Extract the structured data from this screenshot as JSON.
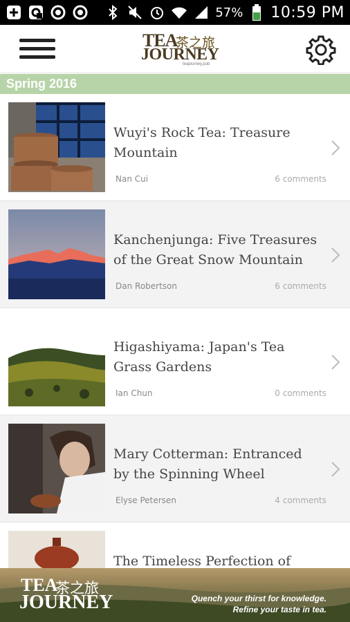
{
  "status_bar": {
    "battery_percent": "57%",
    "time": "10:59 PM",
    "icons": [
      "plus-box-icon",
      "screen-icon",
      "target-icon",
      "target-icon",
      "bluetooth-icon",
      "mute-icon",
      "alarm-icon",
      "wifi-icon",
      "signal-icon",
      "battery-icon"
    ]
  },
  "app_bar": {
    "logo": {
      "tea": "TEA",
      "cn": "茶之旅",
      "journey": "JOURNEY",
      "url": "teajourney.pub"
    }
  },
  "section": {
    "title": "Spring 2016"
  },
  "articles": [
    {
      "title": "Wuyi's Rock Tea: Treasure Mountain",
      "author": "Nan Cui",
      "comments": "6 comments"
    },
    {
      "title": "Kanchenjunga: Five Treasures of the Great Snow Mountain",
      "author": "Dan Robertson",
      "comments": "6 comments"
    },
    {
      "title": "Higashiyama: Japan's Tea Grass Gardens",
      "author": "Ian Chun",
      "comments": "0 comments"
    },
    {
      "title": "Mary Cotterman: Entranced by the Spinning Wheel",
      "author": "Elyse Petersen",
      "comments": "4 comments"
    },
    {
      "title": "The Timeless Perfection of",
      "author": "",
      "comments": ""
    }
  ],
  "banner": {
    "logo_tea": "TEA",
    "logo_cn": "茶之旅",
    "logo_journey": "JOURNEY",
    "tagline1": "Quench your thirst for knowledge.",
    "tagline2": "Refine your taste in tea."
  },
  "colors": {
    "section_header": "#b7d4a8",
    "text_dark": "#444444",
    "meta": "#888888"
  }
}
